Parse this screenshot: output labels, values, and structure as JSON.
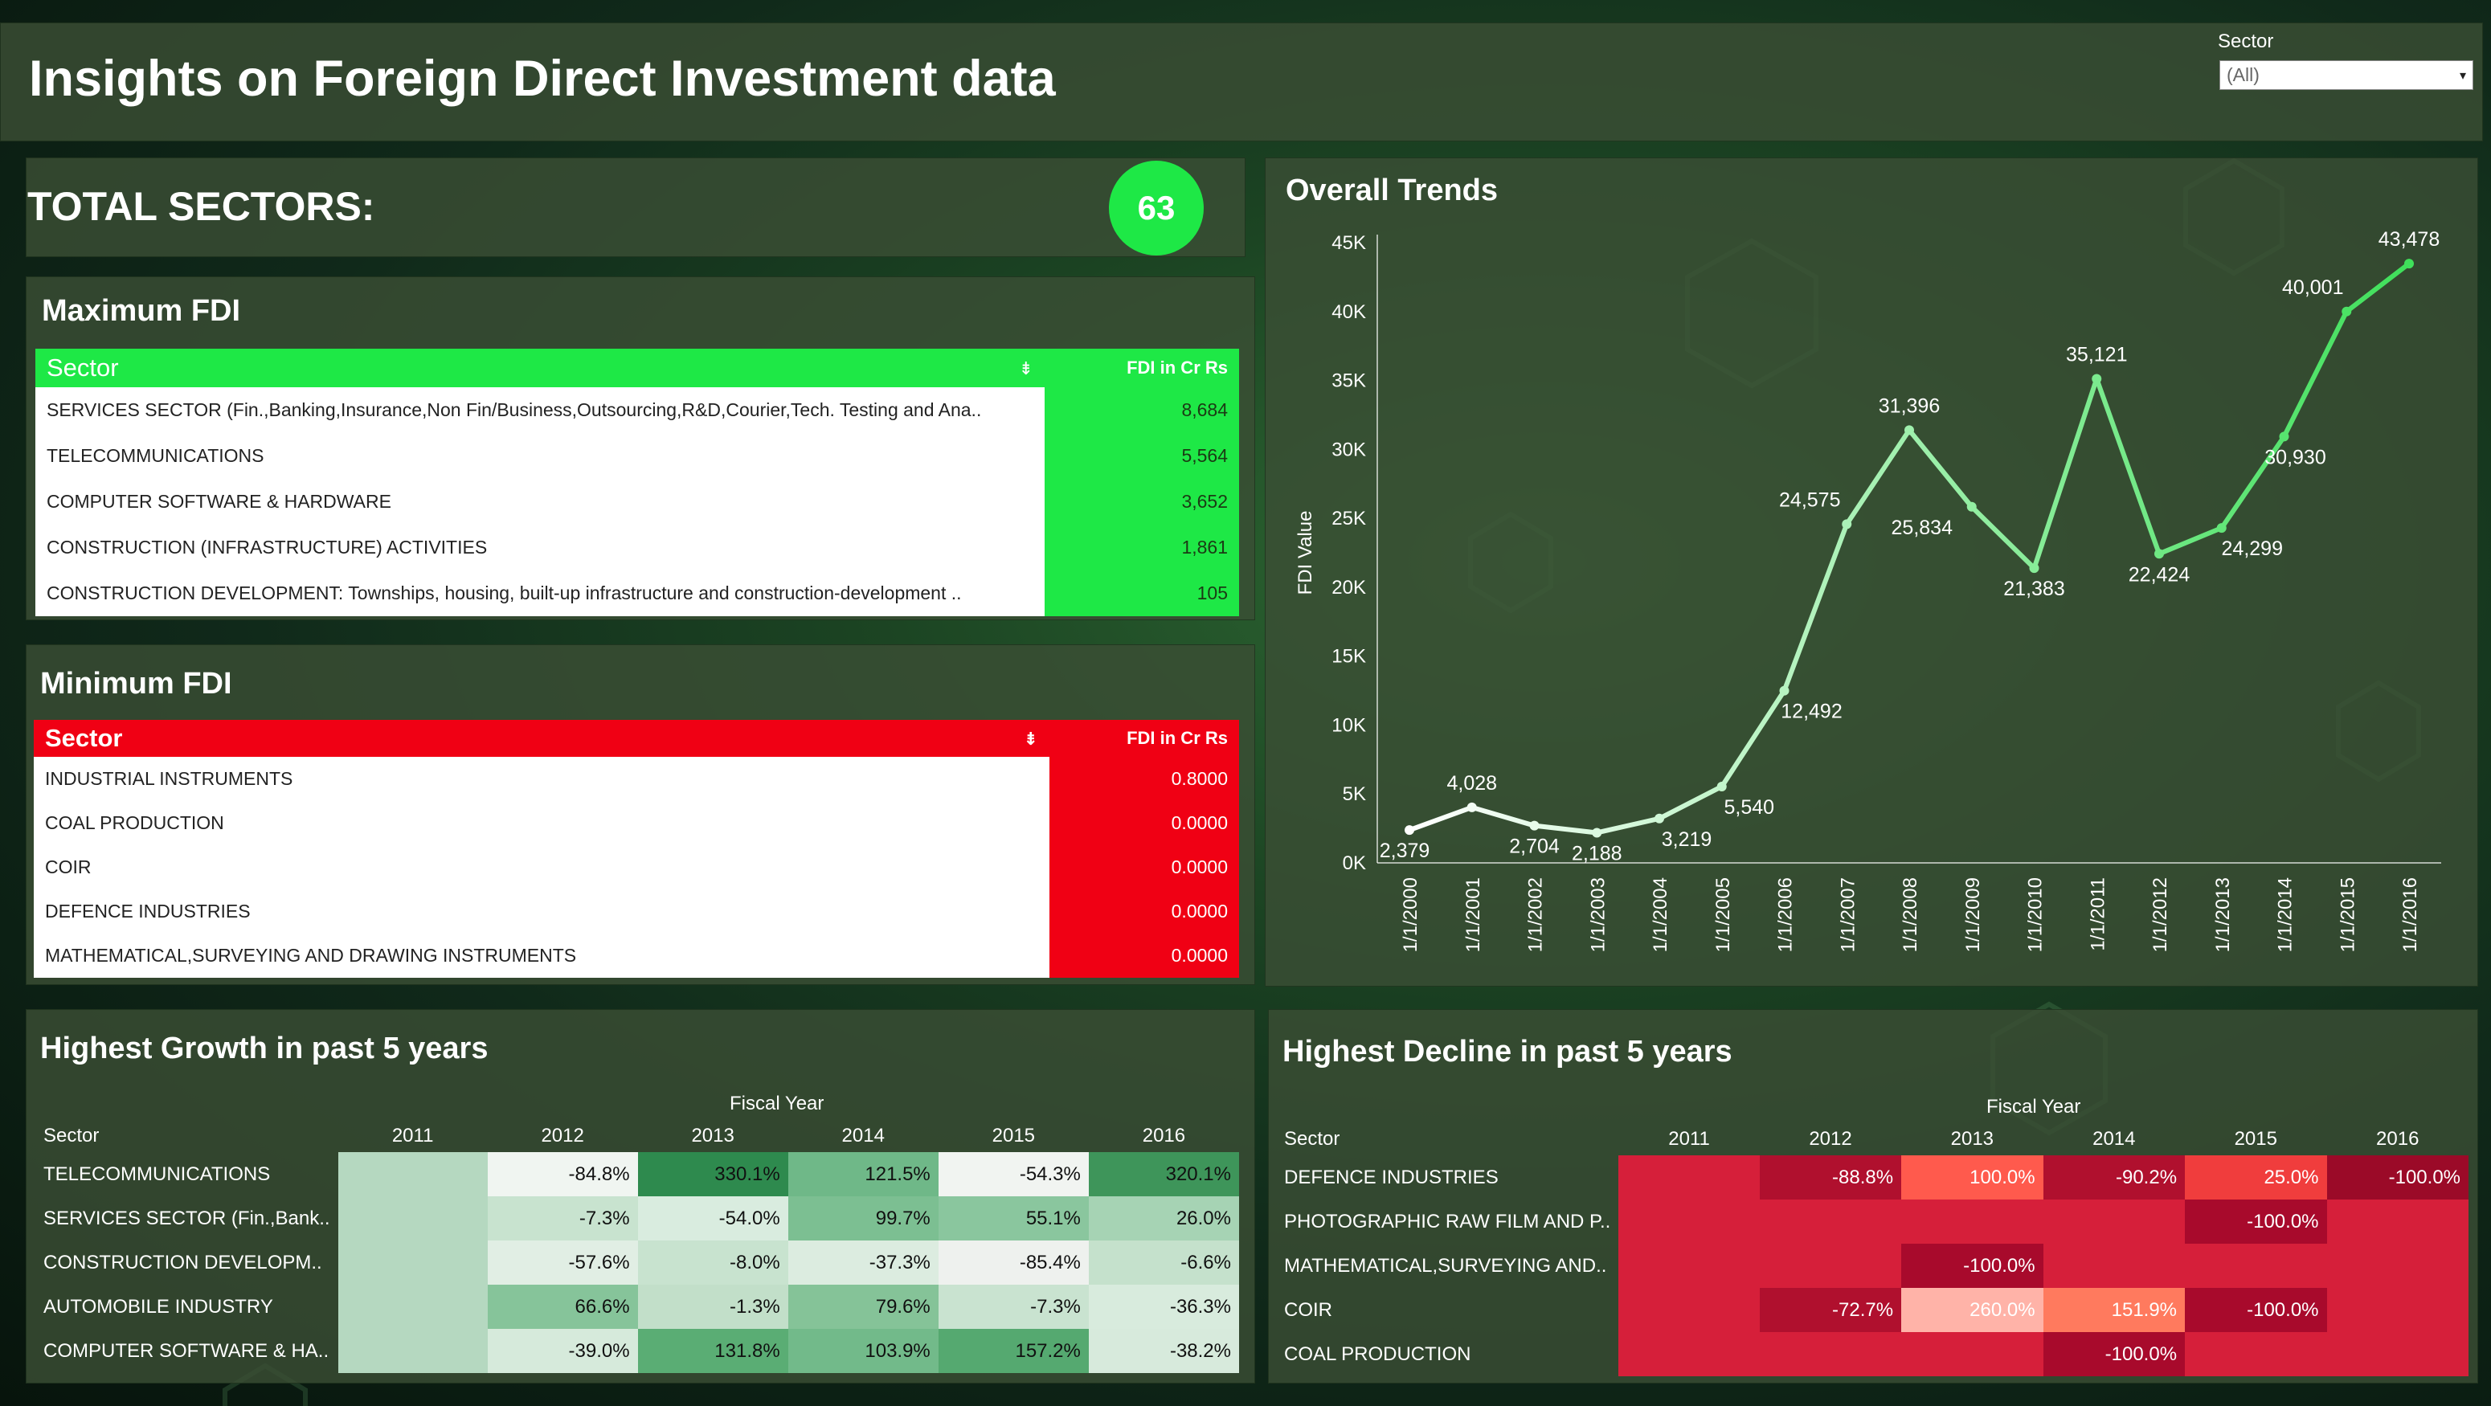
{
  "header": {
    "title": "Insights on Foreign Direct Investment data",
    "filter_label": "Sector",
    "filter_value": "(All)"
  },
  "total": {
    "label": "TOTAL SECTORS:",
    "value": "63"
  },
  "max_fdi": {
    "title": "Maximum FDI",
    "col_sector": "Sector",
    "col_value": "FDI in Cr Rs",
    "rows": [
      {
        "name": "SERVICES SECTOR (Fin.,Banking,Insurance,Non Fin/Business,Outsourcing,R&D,Courier,Tech. Testing and Ana..",
        "value": "8,684"
      },
      {
        "name": "TELECOMMUNICATIONS",
        "value": "5,564"
      },
      {
        "name": "COMPUTER SOFTWARE & HARDWARE",
        "value": "3,652"
      },
      {
        "name": "CONSTRUCTION (INFRASTRUCTURE) ACTIVITIES",
        "value": "1,861"
      },
      {
        "name": "CONSTRUCTION DEVELOPMENT: Townships, housing, built-up infrastructure and construction-development ..",
        "value": "105"
      }
    ]
  },
  "min_fdi": {
    "title": "Minimum FDI",
    "col_sector": "Sector",
    "col_value": "FDI in Cr Rs",
    "rows": [
      {
        "name": "INDUSTRIAL INSTRUMENTS",
        "value": "0.8000"
      },
      {
        "name": "COAL PRODUCTION",
        "value": "0.0000"
      },
      {
        "name": "COIR",
        "value": "0.0000"
      },
      {
        "name": "DEFENCE INDUSTRIES",
        "value": "0.0000"
      },
      {
        "name": "MATHEMATICAL,SURVEYING AND DRAWING INSTRUMENTS",
        "value": "0.0000"
      }
    ]
  },
  "growth": {
    "title": "Highest Growth in past 5 years",
    "fiscal_label": "Fiscal Year",
    "col_sector": "Sector",
    "years": [
      "2011",
      "2012",
      "2013",
      "2014",
      "2015",
      "2016"
    ],
    "rows": [
      {
        "name": "TELECOMMUNICATIONS",
        "values": [
          "",
          "-84.8%",
          "330.1%",
          "121.5%",
          "-54.3%",
          "320.1%"
        ]
      },
      {
        "name": "SERVICES SECTOR (Fin.,Bank..",
        "values": [
          "",
          "-7.3%",
          "-54.0%",
          "99.7%",
          "55.1%",
          "26.0%"
        ]
      },
      {
        "name": "CONSTRUCTION DEVELOPM..",
        "values": [
          "",
          "-57.6%",
          "-8.0%",
          "-37.3%",
          "-85.4%",
          "-6.6%"
        ]
      },
      {
        "name": "AUTOMOBILE INDUSTRY",
        "values": [
          "",
          "66.6%",
          "-1.3%",
          "79.6%",
          "-7.3%",
          "-36.3%"
        ]
      },
      {
        "name": "COMPUTER SOFTWARE & HA..",
        "values": [
          "",
          "-39.0%",
          "131.8%",
          "103.9%",
          "157.2%",
          "-38.2%"
        ]
      }
    ],
    "colors": [
      [
        "#b5d8c0",
        "#f0f5f1",
        "#2e8a4e",
        "#6fb888",
        "#f1f4f1",
        "#3e955a"
      ],
      [
        "#b5d8c0",
        "#c8e3cf",
        "#d9ecdf",
        "#7cbf92",
        "#8ac69e",
        "#a6d3b4"
      ],
      [
        "#b5d8c0",
        "#e1eee4",
        "#c8e3cf",
        "#dcece0",
        "#eef1ee",
        "#c5e1cc"
      ],
      [
        "#b5d8c0",
        "#86c49a",
        "#c2dfc9",
        "#85c398",
        "#c9e3d0",
        "#d8ebdd"
      ],
      [
        "#b5d8c0",
        "#d6eadb",
        "#5aad74",
        "#72ba8a",
        "#55a970",
        "#d7eadc"
      ]
    ]
  },
  "decline": {
    "title": "Highest Decline in past 5 years",
    "fiscal_label": "Fiscal Year",
    "col_sector": "Sector",
    "years": [
      "2011",
      "2012",
      "2013",
      "2014",
      "2015",
      "2016"
    ],
    "rows": [
      {
        "name": "DEFENCE INDUSTRIES",
        "values": [
          "",
          "-88.8%",
          "100.0%",
          "-90.2%",
          "25.0%",
          "-100.0%"
        ]
      },
      {
        "name": "PHOTOGRAPHIC RAW FILM AND P..",
        "values": [
          "",
          "",
          "",
          "",
          "-100.0%",
          ""
        ]
      },
      {
        "name": "MATHEMATICAL,SURVEYING AND..",
        "values": [
          "",
          "",
          "-100.0%",
          "",
          "",
          ""
        ]
      },
      {
        "name": "COIR",
        "values": [
          "",
          "-72.7%",
          "260.0%",
          "151.9%",
          "-100.0%",
          ""
        ]
      },
      {
        "name": "COAL PRODUCTION",
        "values": [
          "",
          "",
          "",
          "-100.0%",
          "",
          ""
        ]
      }
    ],
    "colors": [
      [
        "#d61f3a",
        "#b0102e",
        "#ff5a4d",
        "#b0102e",
        "#f03d3d",
        "#9b0a28"
      ],
      [
        "#d61f3a",
        "#d61f3a",
        "#d61f3a",
        "#d61f3a",
        "#a80a2c",
        "#d61f3a"
      ],
      [
        "#d61f3a",
        "#d61f3a",
        "#a80a2c",
        "#d61f3a",
        "#d61f3a",
        "#d61f3a"
      ],
      [
        "#d61f3a",
        "#b0102e",
        "#ffb3a8",
        "#ff7a5e",
        "#a80a2c",
        "#d61f3a"
      ],
      [
        "#d61f3a",
        "#d61f3a",
        "#d61f3a",
        "#a80a2c",
        "#d61f3a",
        "#d61f3a"
      ]
    ]
  },
  "trend": {
    "title": "Overall Trends"
  },
  "chart_data": {
    "type": "line",
    "title": "Overall Trends",
    "ylabel": "FDI Value",
    "xlabel": "",
    "ylim": [
      0,
      45000
    ],
    "yticks": [
      "0K",
      "5K",
      "10K",
      "15K",
      "20K",
      "25K",
      "30K",
      "35K",
      "40K",
      "45K"
    ],
    "x": [
      "1/1/2000",
      "1/1/2001",
      "1/1/2002",
      "1/1/2003",
      "1/1/2004",
      "1/1/2005",
      "1/1/2006",
      "1/1/2007",
      "1/1/2008",
      "1/1/2009",
      "1/1/2010",
      "1/1/2011",
      "1/1/2012",
      "1/1/2013",
      "1/1/2014",
      "1/1/2015",
      "1/1/2016"
    ],
    "values": [
      2379,
      4028,
      2704,
      2188,
      3219,
      5540,
      12492,
      24575,
      31396,
      25834,
      21383,
      35121,
      22424,
      24299,
      30930,
      40001,
      43478
    ],
    "labels": [
      "2,379",
      "4,028",
      "2,704",
      "2,188",
      "3,219",
      "5,540",
      "12,492",
      "24,575",
      "31,396",
      "25,834",
      "21,383",
      "35,121",
      "22,424",
      "24,299",
      "30,930",
      "40,001",
      "43,478"
    ],
    "color_start": "#ffffff",
    "color_end": "#3fe05a",
    "grid": false
  }
}
